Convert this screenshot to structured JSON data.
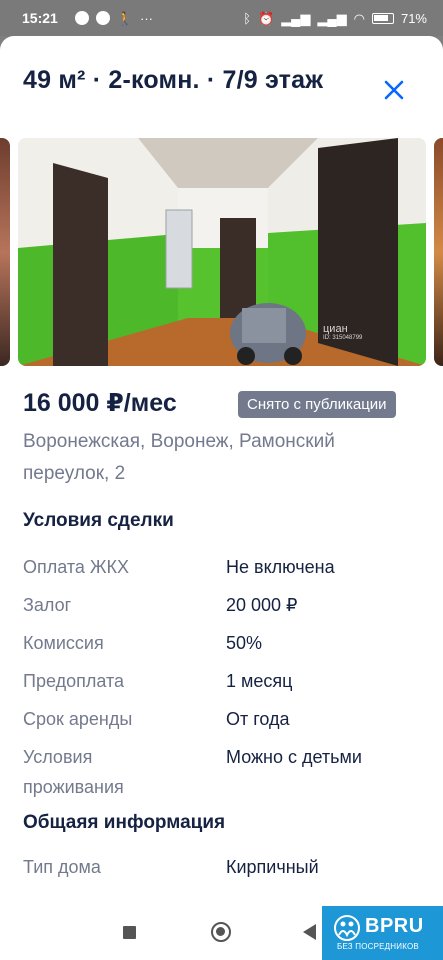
{
  "status_bar": {
    "time": "15:21",
    "dots": "···",
    "battery_percent": "71%"
  },
  "header": {
    "title": "49 м² · 2-комн. · 7/9 этаж",
    "close_icon": "close-icon"
  },
  "gallery": {
    "watermark": "циан",
    "watermark_id": "ID: 315048799"
  },
  "listing": {
    "price": "16 000 ₽/мес",
    "status_badge": "Снято с публикации",
    "address": "Воронежская, Воронеж, Рамонский переулок, 2"
  },
  "deal_terms": {
    "heading": "Условия сделки",
    "rows": [
      {
        "label": "Оплата ЖКХ",
        "value": "Не включена"
      },
      {
        "label": "Залог",
        "value": "20 000 ₽"
      },
      {
        "label": "Комиссия",
        "value": "50%"
      },
      {
        "label": "Предоплата",
        "value": "1 месяц"
      },
      {
        "label": "Срок аренды",
        "value": "От года"
      },
      {
        "label": "Условия проживания",
        "value": "Можно с детьми"
      }
    ]
  },
  "general_info": {
    "heading": "Общаяя информация",
    "rows": [
      {
        "label": "Тип дома",
        "value": "Кирпичный"
      }
    ]
  },
  "nav": {
    "recents_icon": "square-icon",
    "home_icon": "circle-icon",
    "back_icon": "back-triangle-icon"
  },
  "brand_badge": {
    "name": "BPRU",
    "tagline": "БЕЗ ПОСРЕДНИКОВ",
    "color": "#1d97d6"
  },
  "colors": {
    "primary_text": "#152242",
    "secondary_text": "#737a8e",
    "accent": "#0468ff",
    "badge_bg": "#737a8e"
  }
}
